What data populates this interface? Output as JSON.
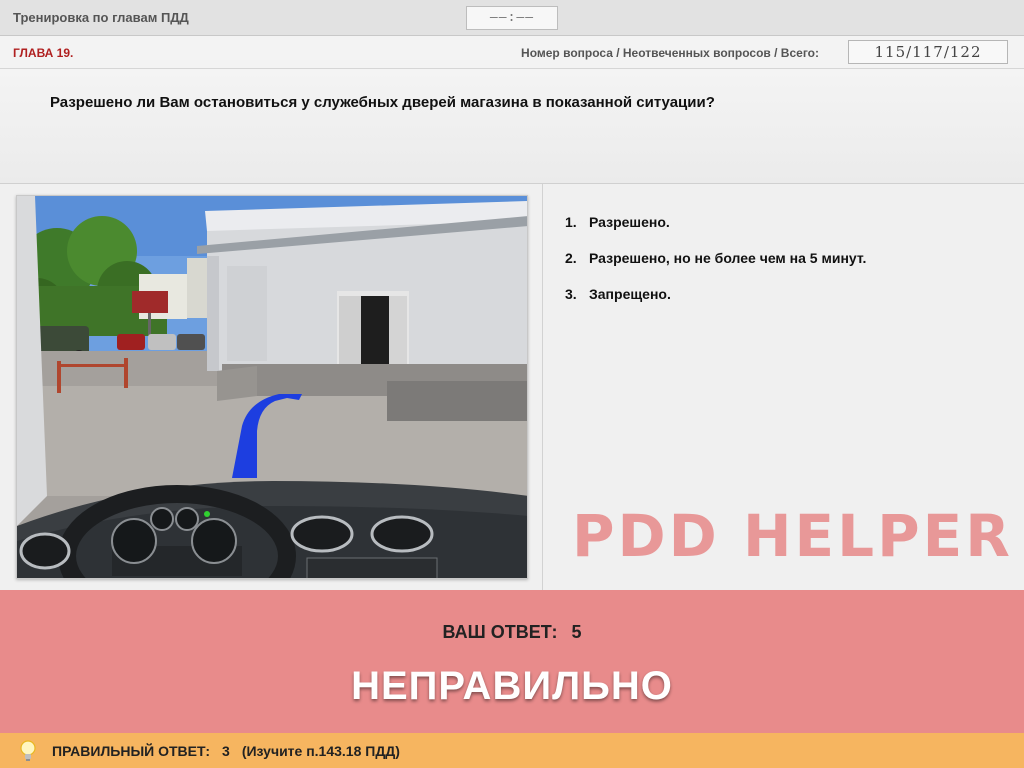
{
  "header": {
    "title": "Тренировка по главам ПДД",
    "timer": "––:––"
  },
  "chapter_bar": {
    "chapter": "ГЛАВА 19.",
    "counter_label": "Номер вопроса / Неотвеченных вопросов / Всего:",
    "counter_value": "115/117/122"
  },
  "question": {
    "text": "Разрешено ли Вам остановиться у служебных дверей магазина в показанной ситуации?"
  },
  "answers": [
    {
      "num": "1.",
      "text": "Разрешено."
    },
    {
      "num": "2.",
      "text": "Разрешено, но не более чем на 5 минут."
    },
    {
      "num": "3.",
      "text": "Запрещено."
    }
  ],
  "watermark": "PDD HELPER",
  "result": {
    "your_answer_label": "ВАШ ОТВЕТ:",
    "your_answer_value": "5",
    "verdict": "НЕПРАВИЛЬНО"
  },
  "correct": {
    "label": "ПРАВИЛЬНЫЙ ОТВЕТ:",
    "value": "3",
    "hint": "(Изучите п.143.18 ПДД)"
  },
  "colors": {
    "chapter": "#b02020",
    "result_bg": "#e88b8b",
    "correct_bar_bg": "#f6b560",
    "watermark": "#e88f8f"
  },
  "icons": {
    "correct_bar": "lightbulb-icon"
  }
}
